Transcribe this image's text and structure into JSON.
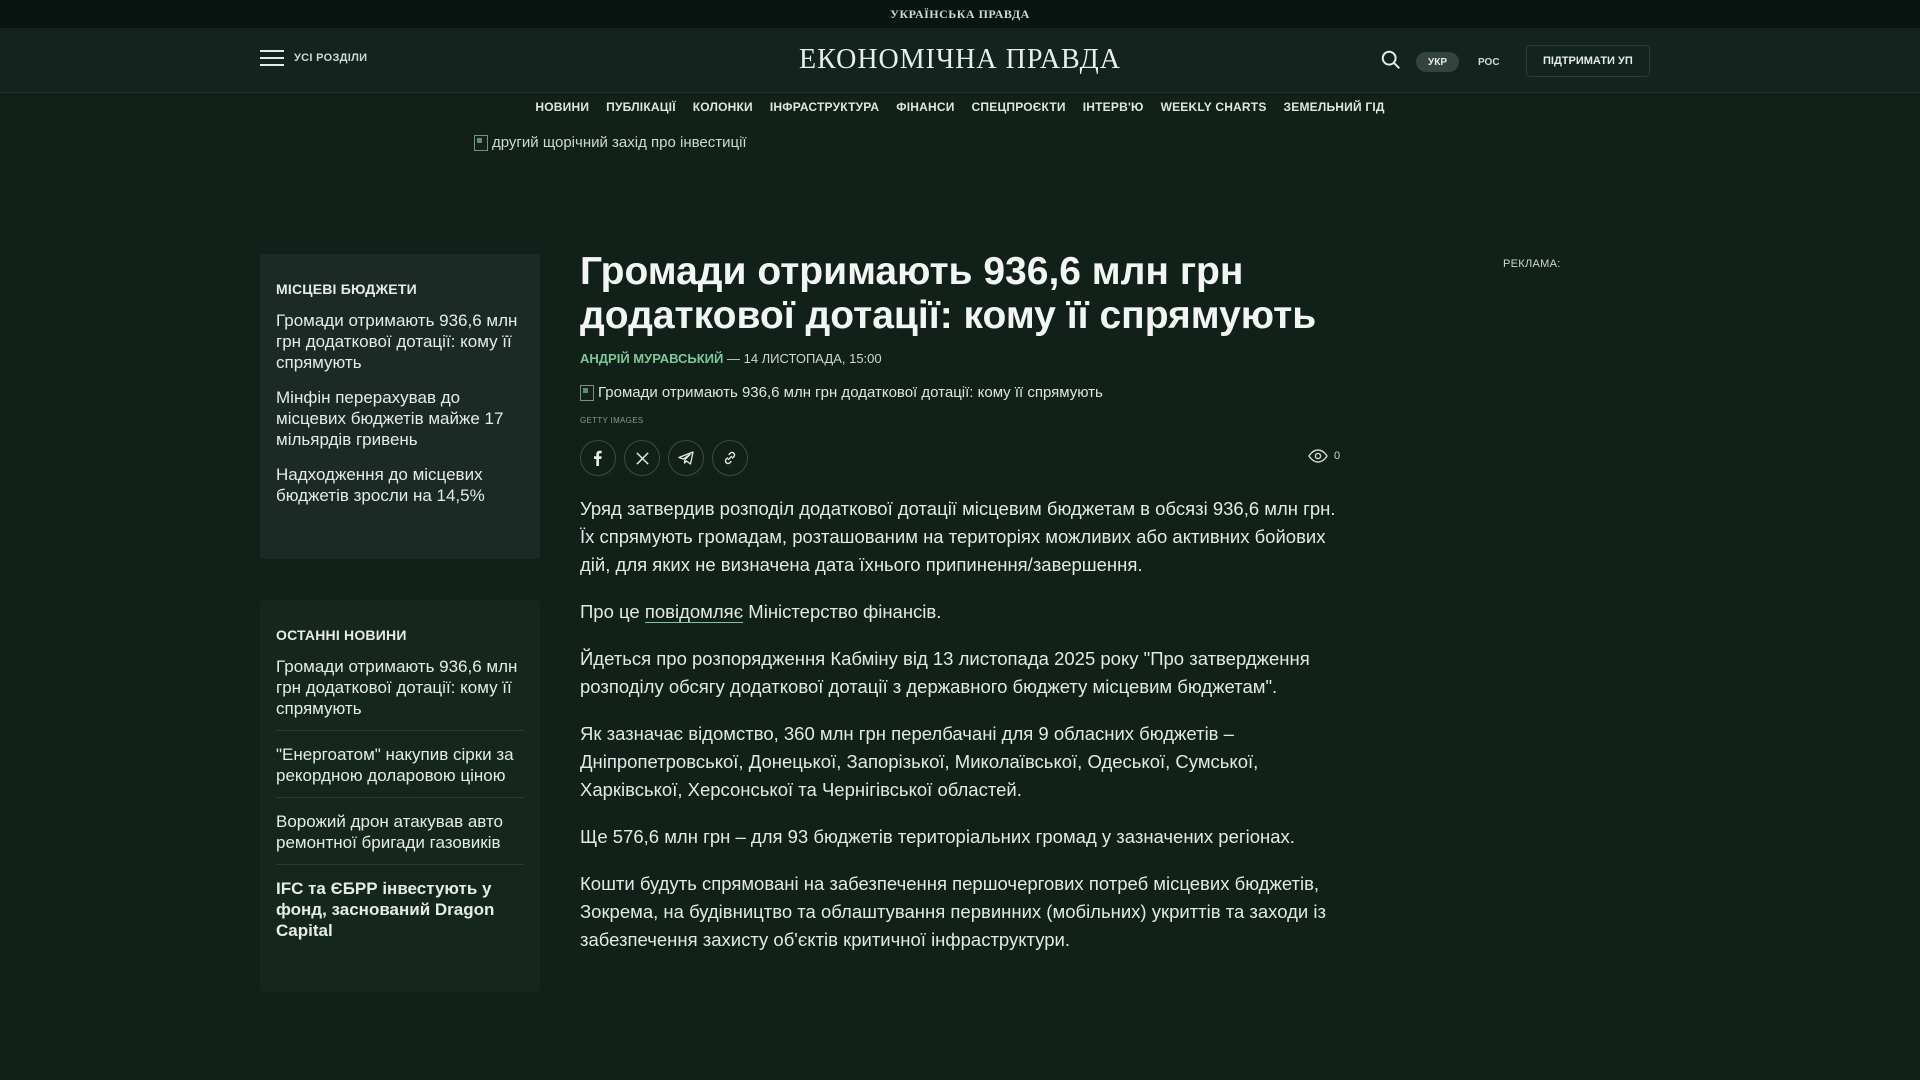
{
  "topbar": {
    "logo": "УКРАЇНСЬКА ПРАВДА"
  },
  "header": {
    "menu_label": "УСІ РОЗДІЛИ",
    "brand": "ЕКОНОМІЧНА ПРАВДА",
    "lang_ukr": "УКР",
    "lang_ros": "РОС",
    "support": "ПІДТРИМАТИ УП"
  },
  "nav": [
    "НОВИНИ",
    "ПУБЛІКАЦІЇ",
    "КОЛОНКИ",
    "ІНФРАСТРУКТУРА",
    "ФІНАНСИ",
    "СПЕЦПРОЄКТИ",
    "ІНТЕРВ'Ю",
    "WEEKLY CHARTS",
    "ЗЕМЕЛЬНИЙ ГІД"
  ],
  "banner_alt": "другий щорічний захід про інвестиції",
  "local_budgets": {
    "title": "МІСЦЕВІ БЮДЖЕТИ",
    "items": [
      "Громади отримають 936,6 млн грн додаткової дотації: кому її спрямують",
      "Мінфін перерахував до місцевих бюджетів майже 17 мільярдів гривень",
      "Надходження до місцевих бюджетів зросли на 14,5%"
    ]
  },
  "latest_news": {
    "title": "ОСТАННІ НОВИНИ",
    "items": [
      "Громади отримають 936,6 млн грн додаткової дотації: кому її спрямують",
      "\"Енергоатом\" накупив сірки за рекордною доларовою ціною",
      "Ворожий дрон атакував авто ремонтної бригади газовиків",
      "IFC та ЄБРР інвестують у фонд, заснований Dragon Capital"
    ]
  },
  "article": {
    "headline": "Громади отримають 936,6 млн грн додаткової дотації: кому її спрямують",
    "author": "АНДРІЙ МУРАВСЬКИЙ",
    "date": " — 14 ЛИСТОПАДА, 15:00",
    "photo_alt": "Громади отримають 936,6 млн грн додаткової дотації: кому її спрямують",
    "photo_credit": "GETTY IMAGES",
    "views": "0",
    "p1": "Уряд затвердив розподіл додаткової дотації місцевим бюджетам в обсязі 936,6 млн грн. Їх спрямують громадам, розташованим на територіях можливих або активних бойових дій, для яких не визначена дата їхнього припинення/завершення.",
    "p2_pre": "Про це ",
    "p2_link": "повідомляє",
    "p2_post": " Міністерство фінансів.",
    "p3": "Йдеться про розпорядження Кабміну від 13 листопада 2025 року \"Про затвердження розподілу обсягу додаткової дотації з державного бюджету місцевим бюджетам\".",
    "p4": "Як зазначає відомство, 360 млн грн перелбачані для 9 обласних бюджетів – Дніпропетровської, Донецької, Запорізької, Миколаївської, Одеської, Сумської, Харківської, Херсонської та Чернігівської областей.",
    "p5": "Ще 576,6 млн грн – для 93 бюджетів територіальних громад у зазначених регіонах.",
    "p6": "Кошти будуть спрямовані на забезпечення першочергових потреб місцевих бюджетів, Зокрема, на будівництво та облаштування первинних (мобільних) укриттів та заходи із забезпечення захисту об'єктів критичної інфраструктури."
  },
  "ad_label": "РЕКЛАМА:",
  "colors": {
    "background": "#112019",
    "accent": "#7fc79b"
  }
}
